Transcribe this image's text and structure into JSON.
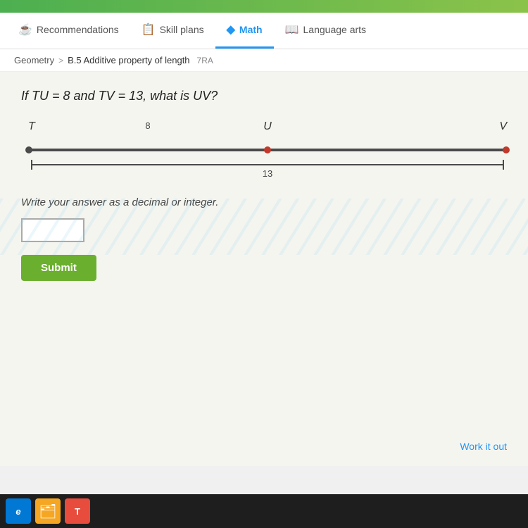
{
  "topbar": {},
  "nav": {
    "tabs": [
      {
        "id": "recommendations",
        "label": "Recommendations",
        "icon": "☕",
        "active": false
      },
      {
        "id": "skill-plans",
        "label": "Skill plans",
        "icon": "📋",
        "active": false
      },
      {
        "id": "math",
        "label": "Math",
        "icon": "◆",
        "active": true
      },
      {
        "id": "language-arts",
        "label": "Language arts",
        "icon": "📖",
        "active": false
      }
    ]
  },
  "breadcrumb": {
    "parent": "Geometry",
    "separator": ">",
    "current": "B.5 Additive property of length",
    "tag": "7RA"
  },
  "question": {
    "text": "If TU = 8 and TV = 13, what is UV?"
  },
  "diagram": {
    "points": [
      "T",
      "U",
      "V"
    ],
    "segment_tu_label": "8",
    "segment_tv_label": "13"
  },
  "answer_instruction": "Write your answer as a decimal or integer.",
  "answer_input_placeholder": "",
  "submit_label": "Submit",
  "work_it_out": "Work it out",
  "taskbar": {
    "icons": [
      {
        "id": "edge",
        "label": "e"
      },
      {
        "id": "folder",
        "label": "🗂"
      },
      {
        "id": "app",
        "label": "T"
      }
    ]
  }
}
